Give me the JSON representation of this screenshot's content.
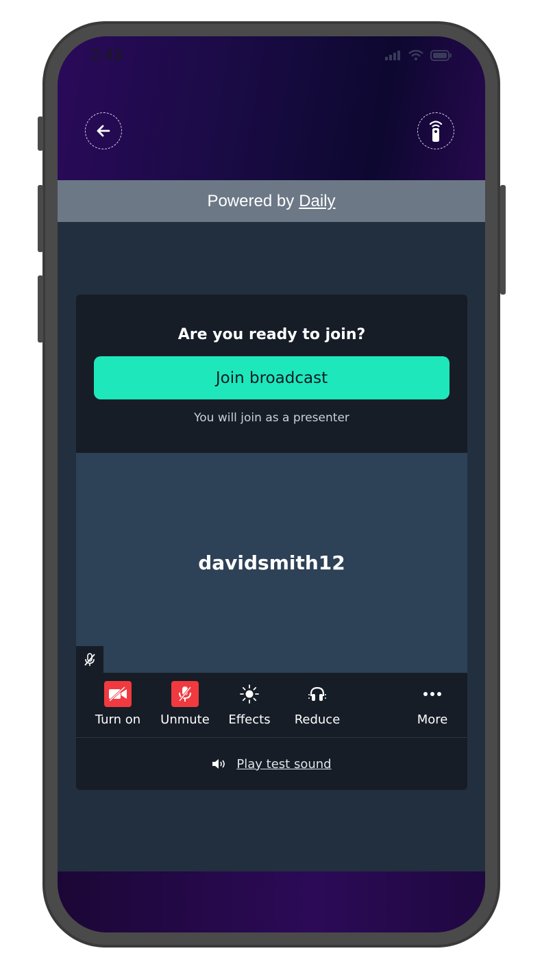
{
  "status_bar": {
    "time": "2:43"
  },
  "header": {
    "back_icon": "arrow-left-icon",
    "broadcast_icon": "remote-icon"
  },
  "powered_by": {
    "prefix": "Powered by",
    "link": "Daily"
  },
  "join_card": {
    "title": "Are you ready to join?",
    "join_button": "Join broadcast",
    "subtitle": "You will join as a presenter"
  },
  "tile": {
    "username": "davidsmith12"
  },
  "controls": [
    {
      "label": "Turn on",
      "icon": "camera-off-icon"
    },
    {
      "label": "Unmute",
      "icon": "mic-off-icon"
    },
    {
      "label": "Effects",
      "icon": "sun-icon"
    },
    {
      "label": "Reduce",
      "icon": "headphones-icon"
    },
    {
      "label": "More",
      "icon": "more-icon"
    }
  ],
  "test_sound": {
    "label": "Play test sound"
  },
  "colors": {
    "accent": "#1ee8bb",
    "danger": "#f03a3f",
    "banner": "#6c7886",
    "card_bg": "#161d26",
    "tile_bg": "#2d4157"
  }
}
